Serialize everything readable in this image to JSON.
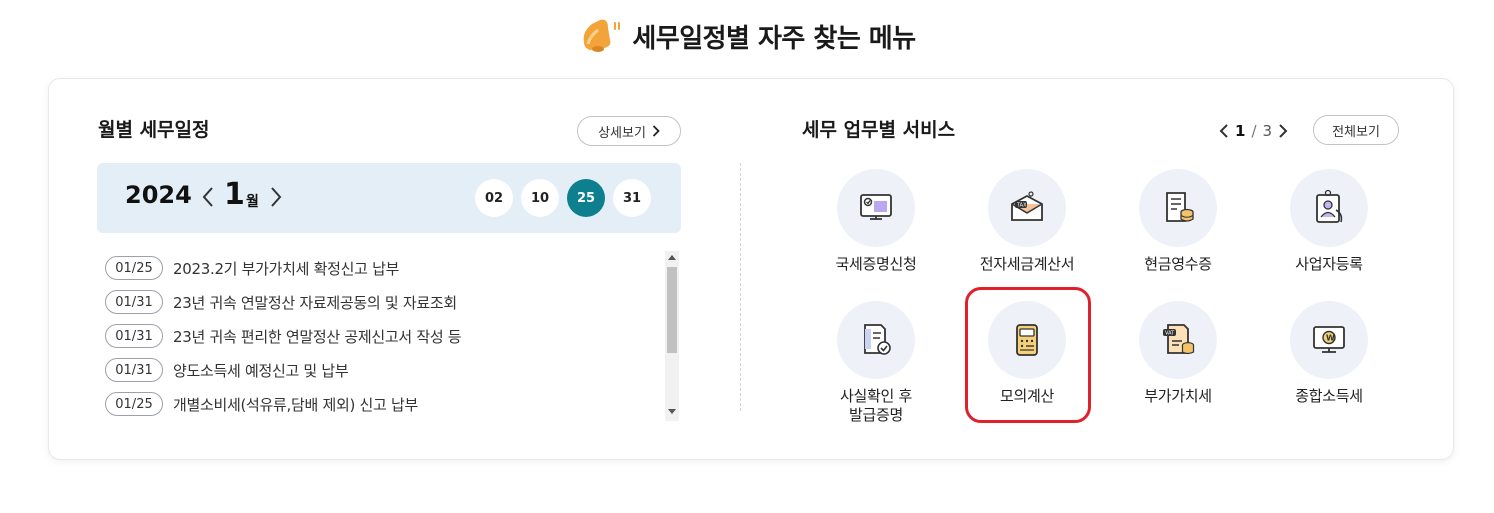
{
  "section": {
    "title": "세무일정별 자주 찾는 메뉴"
  },
  "schedule": {
    "title": "월별 세무일정",
    "detail_label": "상세보기",
    "year": "2024",
    "month": "1",
    "month_unit": "월",
    "days": [
      "02",
      "10",
      "25",
      "31"
    ],
    "active_day": "25",
    "items": [
      {
        "date": "01/25",
        "text": "2023.2기 부가가치세 확정신고 납부"
      },
      {
        "date": "01/31",
        "text": "23년 귀속 연말정산 자료제공동의 및 자료조회"
      },
      {
        "date": "01/31",
        "text": "23년 귀속 편리한 연말정산 공제신고서 작성 등"
      },
      {
        "date": "01/31",
        "text": "양도소득세 예정신고 및 납부"
      },
      {
        "date": "01/25",
        "text": "개별소비세(석유류,담배 제외) 신고 납부"
      }
    ]
  },
  "services": {
    "title": "세무 업무별 서비스",
    "page_current": "1",
    "page_separator": "/",
    "page_total": "3",
    "all_label": "전체보기",
    "items": [
      {
        "label": "국세증명신청",
        "icon": "monitor-certificate-icon"
      },
      {
        "label": "전자세금계산서",
        "icon": "tax-envelope-icon"
      },
      {
        "label": "현금영수증",
        "icon": "receipt-coins-icon"
      },
      {
        "label": "사업자등록",
        "icon": "business-person-icon"
      },
      {
        "label": "사실확인 후\n발급증명",
        "label_line1": "사실확인 후",
        "label_line2": "발급증명",
        "icon": "document-check-icon"
      },
      {
        "label": "모의계산",
        "icon": "calculator-icon"
      },
      {
        "label": "부가가치세",
        "icon": "vat-document-icon"
      },
      {
        "label": "종합소득세",
        "icon": "income-tax-monitor-icon"
      }
    ],
    "highlighted": "모의계산"
  },
  "colors": {
    "accent": "#0e7f8f",
    "date_bar": "#e3eef7",
    "icon_bg": "#eef2f8",
    "highlight": "#e0202a"
  }
}
